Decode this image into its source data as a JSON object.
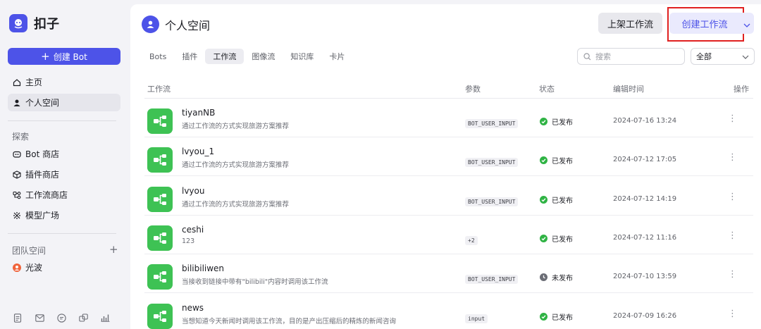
{
  "brand": {
    "name": "扣子"
  },
  "sidebar": {
    "create_bot_label": "创建 Bot",
    "main_items": [
      {
        "label": "主页",
        "icon": "home-icon"
      },
      {
        "label": "个人空间",
        "icon": "user-icon",
        "active": true
      }
    ],
    "explore_label": "探索",
    "explore_items": [
      {
        "label": "Bot 商店",
        "icon": "bot-icon"
      },
      {
        "label": "插件商店",
        "icon": "cube-icon"
      },
      {
        "label": "工作流商店",
        "icon": "workflow-icon"
      },
      {
        "label": "模型广场",
        "icon": "model-icon"
      }
    ],
    "team_label": "团队空间",
    "team_items": [
      {
        "label": "光波",
        "icon": "team-avatar-icon"
      }
    ]
  },
  "header": {
    "title": "个人空间",
    "publish_label": "上架工作流",
    "create_label": "创建工作流"
  },
  "tabs": [
    {
      "label": "Bots"
    },
    {
      "label": "插件"
    },
    {
      "label": "工作流",
      "active": true
    },
    {
      "label": "图像流"
    },
    {
      "label": "知识库"
    },
    {
      "label": "卡片"
    }
  ],
  "search": {
    "placeholder": "搜索"
  },
  "filter": {
    "value": "全部"
  },
  "table": {
    "columns": {
      "workflow": "工作流",
      "params": "参数",
      "status": "状态",
      "edit_time": "编辑时间",
      "actions": "操作"
    },
    "rows": [
      {
        "name": "tiyanNB",
        "desc": "通过工作流的方式实现旅游方案推荐",
        "param": "BOT_USER_INPUT",
        "status": "已发布",
        "published": true,
        "time": "2024-07-16 13:24"
      },
      {
        "name": "lvyou_1",
        "desc": "通过工作流的方式实现旅游方案推荐",
        "param": "BOT_USER_INPUT",
        "status": "已发布",
        "published": true,
        "time": "2024-07-12 17:05"
      },
      {
        "name": "lvyou",
        "desc": "通过工作流的方式实现旅游方案推荐",
        "param": "BOT_USER_INPUT",
        "status": "已发布",
        "published": true,
        "time": "2024-07-12 14:19"
      },
      {
        "name": "ceshi",
        "desc": "123",
        "param": "+2",
        "status": "已发布",
        "published": true,
        "time": "2024-07-12 11:16"
      },
      {
        "name": "bilibiliwen",
        "desc": "当接收到链接中带有\"bilibili\"内容时调用该工作流",
        "param": "BOT_USER_INPUT",
        "status": "未发布",
        "published": false,
        "time": "2024-07-10 13:59"
      },
      {
        "name": "news",
        "desc": "当想知道今天新闻时调用该工作流，目的是产出压缩后的精炼的新闻咨询",
        "param": "input",
        "status": "已发布",
        "published": true,
        "time": "2024-07-09 16:26"
      }
    ]
  },
  "colors": {
    "accent": "#4d53e8",
    "workflow_icon": "#3ec254",
    "published": "#2fb344",
    "unpublished": "#6b6d75",
    "highlight_box": "#e02020"
  }
}
